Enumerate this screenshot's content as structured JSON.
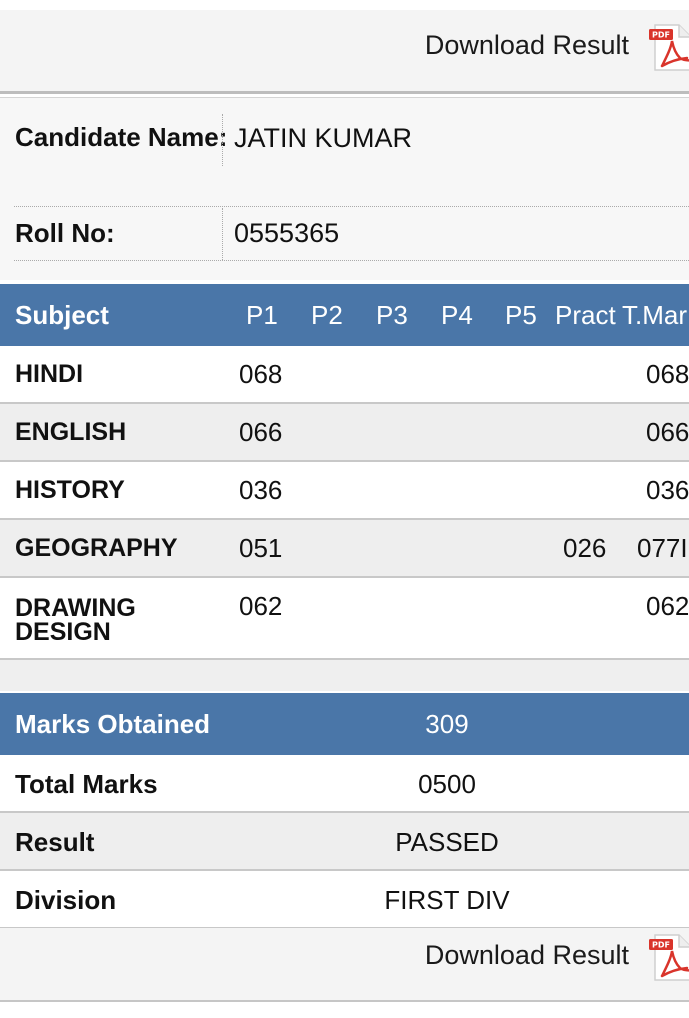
{
  "download": {
    "label": "Download Result",
    "icon": "pdf-icon",
    "icon_text": "PDF"
  },
  "candidate": {
    "name_label": "Candidate Name:",
    "name": "JATIN KUMAR",
    "roll_label": "Roll No:",
    "roll": "0555365"
  },
  "marks_table": {
    "headers": {
      "subject": "Subject",
      "p1": "P1",
      "p2": "P2",
      "p3": "P3",
      "p4": "P4",
      "p5": "P5",
      "pract": "Pract",
      "total": "T.Mar"
    },
    "rows": [
      {
        "subject": "HINDI",
        "p1": "068",
        "pract": "",
        "total": "068"
      },
      {
        "subject": "ENGLISH",
        "p1": "066",
        "pract": "",
        "total": "066"
      },
      {
        "subject": "HISTORY",
        "p1": "036",
        "pract": "",
        "total": "036"
      },
      {
        "subject": "GEOGRAPHY",
        "p1": "051",
        "pract": "026",
        "total": "077I"
      },
      {
        "subject": "DRAWING DESIGN",
        "p1": "062",
        "pract": "",
        "total": "062"
      }
    ]
  },
  "summary": {
    "marks_obtained_label": "Marks Obtained",
    "marks_obtained": "309",
    "total_marks_label": "Total Marks",
    "total_marks": "0500",
    "result_label": "Result",
    "result": "PASSED",
    "division_label": "Division",
    "division": "FIRST DIV"
  },
  "colors": {
    "header_blue": "#4a76a8",
    "row_grey": "#eeeeee",
    "pdf_red": "#d9342b"
  }
}
